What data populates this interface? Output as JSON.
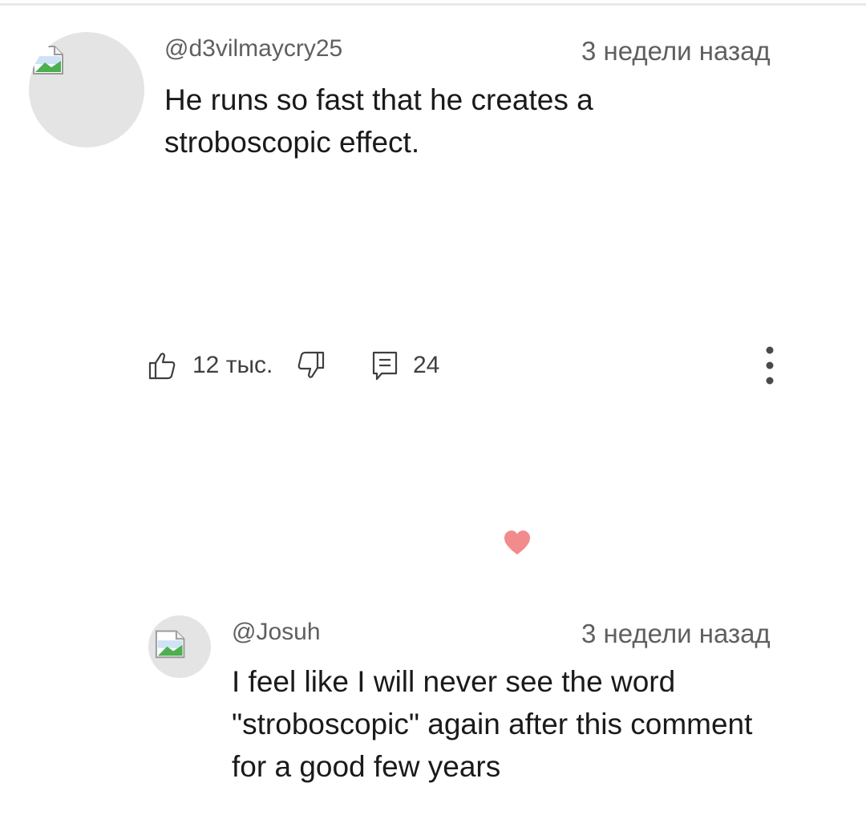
{
  "comments": [
    {
      "author": "@d3vilmaycry25",
      "timestamp": "3 недели назад",
      "text": "He runs so fast that he creates a stroboscopic effect.",
      "likes": "12 тыс.",
      "replies": "24",
      "avatar_icon": "broken-image-icon"
    }
  ],
  "creator_heart": {
    "icon": "heart-icon",
    "color": "#f28b8b"
  },
  "reply": {
    "author": "@Josuh",
    "timestamp": "3 недели назад",
    "text": "I feel like I will never see the word \"stroboscopic\"  again after this comment for a good few years",
    "avatar_icon": "broken-image-icon"
  },
  "icons": {
    "like": "thumbs-up-icon",
    "dislike": "thumbs-down-icon",
    "reply": "comment-icon",
    "more": "more-vertical-icon"
  }
}
